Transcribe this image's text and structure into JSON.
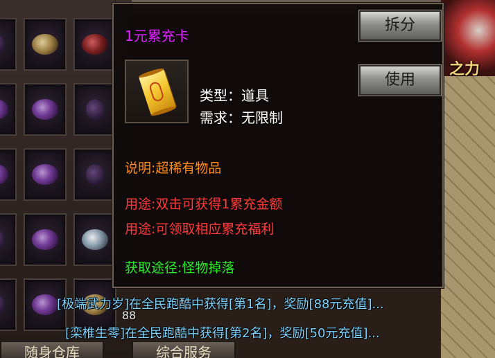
{
  "tooltip": {
    "title": "1元累充卡",
    "title_color": "#e020ff",
    "item_icon": "gold-scroll-card-icon",
    "split_label": "拆分",
    "use_label": "使用",
    "type_line": "类型：道具",
    "require_line": "需求：无限制",
    "description": "说明:超稀有物品",
    "usage_1": "用途:双击可获得1累充金额",
    "usage_2": "用途:可领取相应累充福利",
    "source": "获取途径:怪物掉落",
    "colors": {
      "description": "#ff8c1a",
      "usage": "#ff3a3a",
      "source": "#2aea2a"
    }
  },
  "inventory": {
    "stack_count": "88"
  },
  "broadcast": {
    "line_1": "[极端武力岁]在全民跑酷中获得[第1名]，奖励[88元充值]...",
    "line_2": "[栾椎生零]在全民跑酷中获得[第2名]，奖励[50元充值]...",
    "color": "#7fd4ff"
  },
  "scene": {
    "power_label": "之力"
  },
  "bottom_buttons": {
    "left_label": "随身仓库",
    "right_label": "综合服务"
  }
}
